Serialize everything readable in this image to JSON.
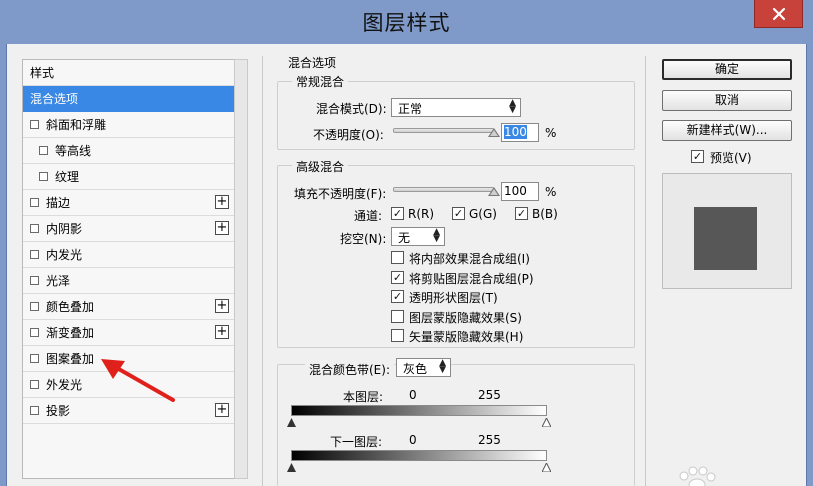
{
  "window": {
    "title": "图层样式"
  },
  "styles_list": {
    "items": [
      {
        "label": "样式",
        "checkbox": false,
        "plus": false,
        "selected": false,
        "indent": 0
      },
      {
        "label": "混合选项",
        "checkbox": false,
        "plus": false,
        "selected": true,
        "indent": 0
      },
      {
        "label": "斜面和浮雕",
        "checkbox": true,
        "plus": false,
        "selected": false,
        "indent": 0
      },
      {
        "label": "等高线",
        "checkbox": true,
        "plus": false,
        "selected": false,
        "indent": 1
      },
      {
        "label": "纹理",
        "checkbox": true,
        "plus": false,
        "selected": false,
        "indent": 1
      },
      {
        "label": "描边",
        "checkbox": true,
        "plus": true,
        "selected": false,
        "indent": 0
      },
      {
        "label": "内阴影",
        "checkbox": true,
        "plus": true,
        "selected": false,
        "indent": 0
      },
      {
        "label": "内发光",
        "checkbox": true,
        "plus": false,
        "selected": false,
        "indent": 0
      },
      {
        "label": "光泽",
        "checkbox": true,
        "plus": false,
        "selected": false,
        "indent": 0
      },
      {
        "label": "颜色叠加",
        "checkbox": true,
        "plus": true,
        "selected": false,
        "indent": 0
      },
      {
        "label": "渐变叠加",
        "checkbox": true,
        "plus": true,
        "selected": false,
        "indent": 0
      },
      {
        "label": "图案叠加",
        "checkbox": true,
        "plus": false,
        "selected": false,
        "indent": 0
      },
      {
        "label": "外发光",
        "checkbox": true,
        "plus": false,
        "selected": false,
        "indent": 0
      },
      {
        "label": "投影",
        "checkbox": true,
        "plus": true,
        "selected": false,
        "indent": 0
      }
    ]
  },
  "blending": {
    "heading": "混合选项",
    "general": {
      "legend": "常规混合",
      "mode_label": "混合模式(D):",
      "mode_value": "正常",
      "opacity_label": "不透明度(O):",
      "opacity_value": "100",
      "opacity_unit": "%",
      "opacity_fraction": 1.0
    },
    "advanced": {
      "legend": "高级混合",
      "fill_label": "填充不透明度(F):",
      "fill_value": "100",
      "fill_unit": "%",
      "fill_fraction": 1.0,
      "channels_label": "通道:",
      "channels": [
        {
          "label": "R(R)",
          "checked": true
        },
        {
          "label": "G(G)",
          "checked": true
        },
        {
          "label": "B(B)",
          "checked": true
        }
      ],
      "knockout_label": "挖空(N):",
      "knockout_value": "无",
      "options": [
        {
          "label": "将内部效果混合成组(I)",
          "checked": false
        },
        {
          "label": "将剪贴图层混合成组(P)",
          "checked": true
        },
        {
          "label": "透明形状图层(T)",
          "checked": true
        },
        {
          "label": "图层蒙版隐藏效果(S)",
          "checked": false
        },
        {
          "label": "矢量蒙版隐藏效果(H)",
          "checked": false
        }
      ]
    },
    "blend_if": {
      "label": "混合颜色带(E):",
      "value": "灰色",
      "this_layer": {
        "label": "本图层:",
        "min": "0",
        "max": "255"
      },
      "underlying": {
        "label": "下一图层:",
        "min": "0",
        "max": "255"
      }
    }
  },
  "buttons": {
    "ok": "确定",
    "cancel": "取消",
    "new_style": "新建样式(W)...",
    "preview_label": "预览(V)",
    "preview_checked": true
  },
  "colors": {
    "selection": "#3a88e5",
    "titlebar": "#7f9ac9",
    "close_button": "#c7423a",
    "annotation_arrow": "#e0201a",
    "preview_swatch": "#575757"
  }
}
